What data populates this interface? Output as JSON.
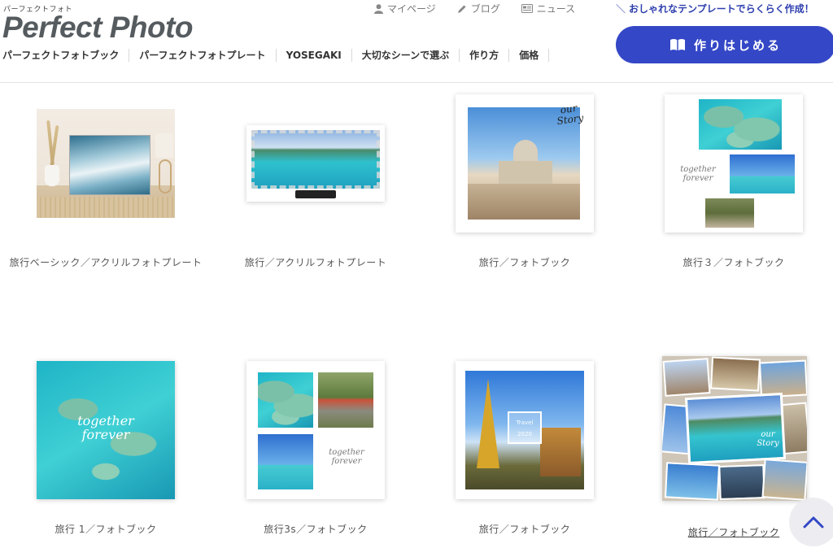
{
  "header": {
    "logo_small": "パーフェクトフォト",
    "logo": "Perfect Photo",
    "utility": [
      {
        "label": "マイページ",
        "icon": "user-icon"
      },
      {
        "label": "ブログ",
        "icon": "pencil-icon"
      },
      {
        "label": "ニュース",
        "icon": "newspaper-icon"
      }
    ],
    "nav": [
      "パーフェクトフォトブック",
      "パーフェクトフォトプレート",
      "YOSEGAKI",
      "大切なシーンで選ぶ",
      "作り方",
      "価格"
    ],
    "tagline": "おしゃれなテンプレートでらくらく作成！",
    "start_button": "作りはじめる"
  },
  "products": [
    {
      "title": "旅行ベーシック／アクリルフォトプレート"
    },
    {
      "title": "旅行／アクリルフォトプレート"
    },
    {
      "title": "旅行／フォトブック",
      "overlay": "our Story"
    },
    {
      "title": "旅行３／フォトブック",
      "overlay": "together forever"
    },
    {
      "title": "旅行 1／フォトブック",
      "overlay": "together forever"
    },
    {
      "title": "旅行3s／フォトブック",
      "overlay": "together forever"
    },
    {
      "title": "旅行／フォトブック",
      "overlay_top": "Travel",
      "overlay_bottom": "2020"
    },
    {
      "title": "旅行／フォトブック",
      "overlay": "our Story"
    }
  ],
  "colors": {
    "accent": "#3447c6",
    "tagline": "#2d3eae",
    "logo": "#555b5e"
  }
}
